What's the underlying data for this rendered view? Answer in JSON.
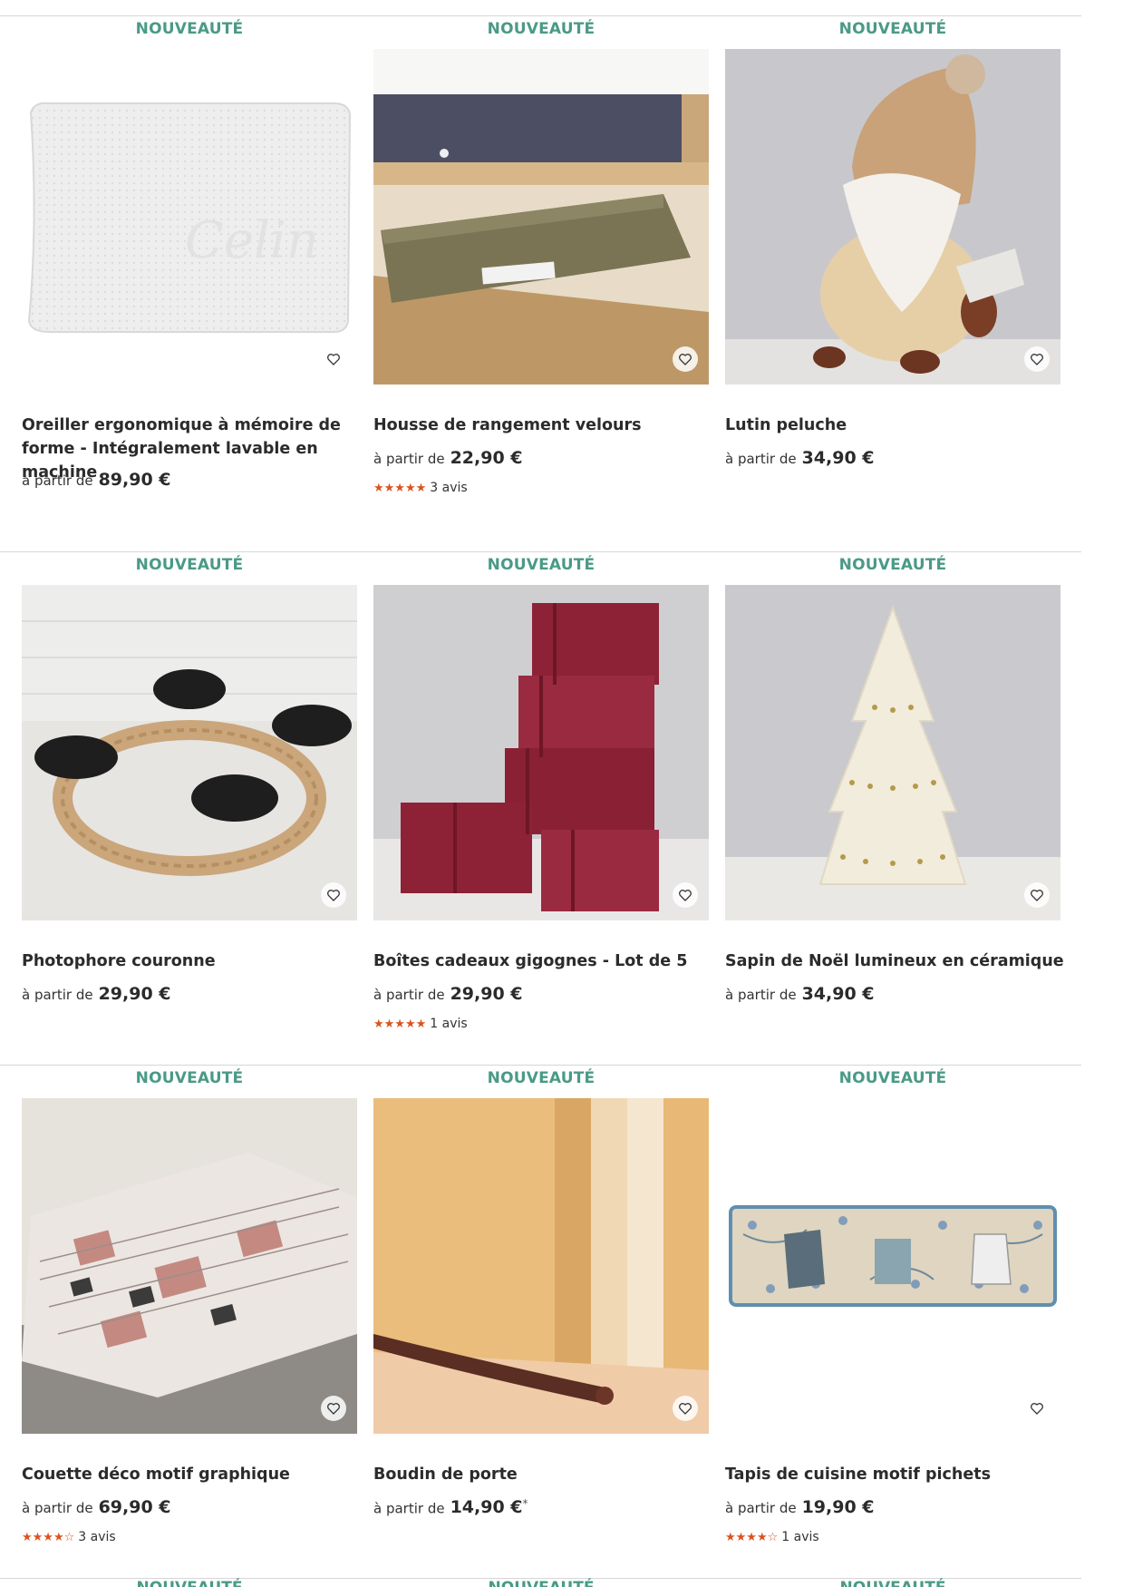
{
  "badge": "NOUVEAUTÉ",
  "price_prefix": "à partir de",
  "products": [
    {
      "name": "Oreiller ergonomique à mémoire de forme - Intégralement lavable en machine",
      "price": "89,90 €",
      "stars": "",
      "reviews": "",
      "image_icon": "pillow-image"
    },
    {
      "name": "Housse de rangement velours",
      "price": "22,90 €",
      "stars": "★★★★★",
      "reviews": "3 avis",
      "image_icon": "storage-bag-image"
    },
    {
      "name": "Lutin peluche",
      "price": "34,90 €",
      "stars": "",
      "reviews": "",
      "image_icon": "gnome-plush-image"
    },
    {
      "name": "Photophore couronne",
      "price": "29,90 €",
      "stars": "",
      "reviews": "",
      "image_icon": "candle-wreath-image"
    },
    {
      "name": "Boîtes cadeaux gigognes - Lot de 5",
      "price": "29,90 €",
      "stars": "★★★★★",
      "reviews": "1 avis",
      "image_icon": "gift-boxes-image"
    },
    {
      "name": "Sapin de Noël lumineux en céramique",
      "price": "34,90 €",
      "stars": "",
      "reviews": "",
      "image_icon": "ceramic-tree-image"
    },
    {
      "name": "Couette déco motif graphique",
      "price": "69,90 €",
      "stars": "★★★★☆",
      "reviews": "3 avis",
      "image_icon": "duvet-image"
    },
    {
      "name": "Boudin de porte",
      "price": "14,90 €",
      "price_note": "*",
      "stars": "",
      "reviews": "",
      "image_icon": "door-draft-stopper-image"
    },
    {
      "name": "Tapis de cuisine motif pichets",
      "price": "19,90 €",
      "stars": "★★★★☆",
      "reviews": "1 avis",
      "image_icon": "kitchen-rug-image"
    }
  ],
  "colors": {
    "badge": "#4a9a86",
    "stars": "#d9541e",
    "divider": "#d6d6d6"
  }
}
